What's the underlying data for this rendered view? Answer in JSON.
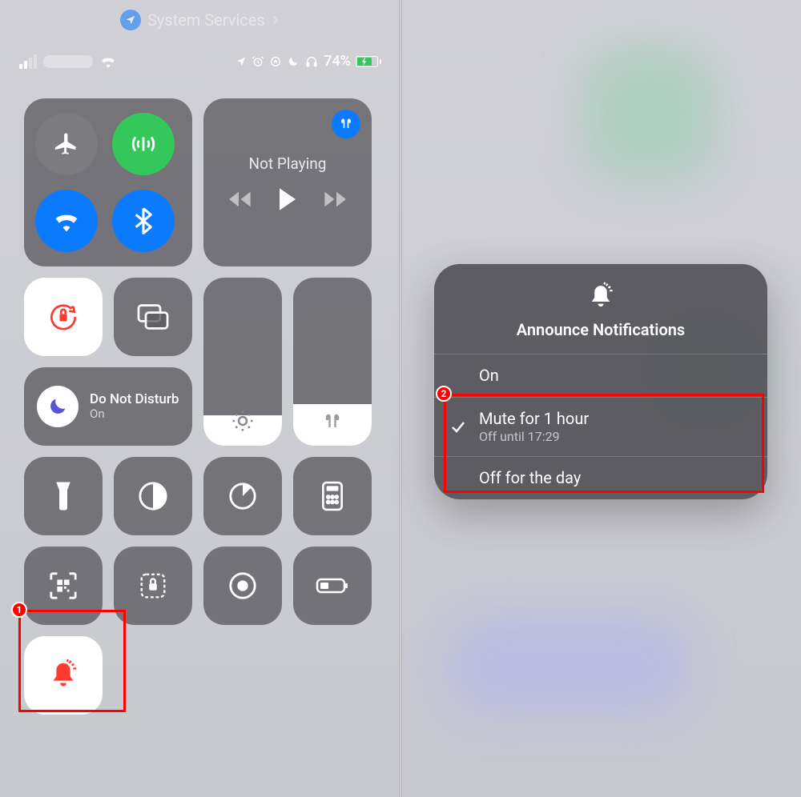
{
  "breadcrumb": {
    "label": "System Services"
  },
  "status": {
    "battery_pct": "74%"
  },
  "media": {
    "not_playing": "Not Playing"
  },
  "dnd": {
    "title": "Do Not Disturb",
    "state": "On"
  },
  "announce": {
    "title": "Announce Notifications",
    "options": [
      {
        "label": "On",
        "sub": "",
        "checked": false
      },
      {
        "label": "Mute for 1 hour",
        "sub": "Off until 17:29",
        "checked": true
      },
      {
        "label": "Off for the day",
        "sub": "",
        "checked": false
      }
    ]
  },
  "annotations": {
    "badge1": "1",
    "badge2": "2"
  }
}
